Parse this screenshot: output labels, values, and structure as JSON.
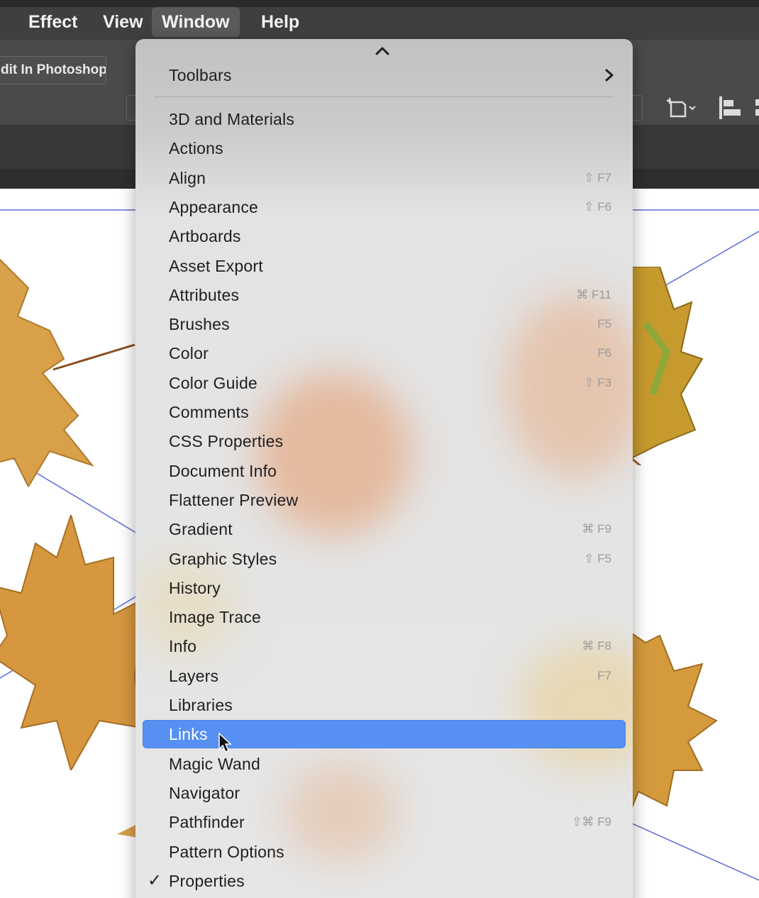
{
  "menubar": {
    "items": [
      {
        "label": "Effect"
      },
      {
        "label": "View"
      },
      {
        "label": "Window"
      },
      {
        "label": "Help"
      }
    ],
    "open_item": "Window"
  },
  "controlbar": {
    "edit_in_photoshop_label": "dit In Photoshop",
    "icons": [
      "artboard-dropdown-icon",
      "align-left-icon"
    ]
  },
  "window_menu": {
    "scroll_indicator": "up-chevron",
    "submenu_item": {
      "label": "Toolbars",
      "has_submenu": true
    },
    "items": [
      {
        "label": "3D and Materials",
        "shortcut": ""
      },
      {
        "label": "Actions",
        "shortcut": ""
      },
      {
        "label": "Align",
        "shortcut": "⇧ F7"
      },
      {
        "label": "Appearance",
        "shortcut": "⇧ F6"
      },
      {
        "label": "Artboards",
        "shortcut": ""
      },
      {
        "label": "Asset Export",
        "shortcut": ""
      },
      {
        "label": "Attributes",
        "shortcut": "⌘ F11"
      },
      {
        "label": "Brushes",
        "shortcut": "F5"
      },
      {
        "label": "Color",
        "shortcut": "F6"
      },
      {
        "label": "Color Guide",
        "shortcut": "⇧ F3"
      },
      {
        "label": "Comments",
        "shortcut": ""
      },
      {
        "label": "CSS Properties",
        "shortcut": ""
      },
      {
        "label": "Document Info",
        "shortcut": ""
      },
      {
        "label": "Flattener Preview",
        "shortcut": ""
      },
      {
        "label": "Gradient",
        "shortcut": "⌘ F9"
      },
      {
        "label": "Graphic Styles",
        "shortcut": "⇧ F5"
      },
      {
        "label": "History",
        "shortcut": ""
      },
      {
        "label": "Image Trace",
        "shortcut": ""
      },
      {
        "label": "Info",
        "shortcut": "⌘ F8"
      },
      {
        "label": "Layers",
        "shortcut": "F7"
      },
      {
        "label": "Libraries",
        "shortcut": ""
      },
      {
        "label": "Links",
        "shortcut": "",
        "highlighted": true
      },
      {
        "label": "Magic Wand",
        "shortcut": ""
      },
      {
        "label": "Navigator",
        "shortcut": ""
      },
      {
        "label": "Pathfinder",
        "shortcut": "⇧⌘ F9"
      },
      {
        "label": "Pattern Options",
        "shortcut": ""
      },
      {
        "label": "Properties",
        "shortcut": "",
        "checked": true
      }
    ],
    "highlight_color": "#5590f2"
  },
  "colors": {
    "menubar_bg": "#3f3f3f",
    "menu_text": "#1f1f1f",
    "shortcut_text": "#9b9b9b",
    "guide_line": "#5b6bd8",
    "leaf_color": "#d9a04a"
  }
}
